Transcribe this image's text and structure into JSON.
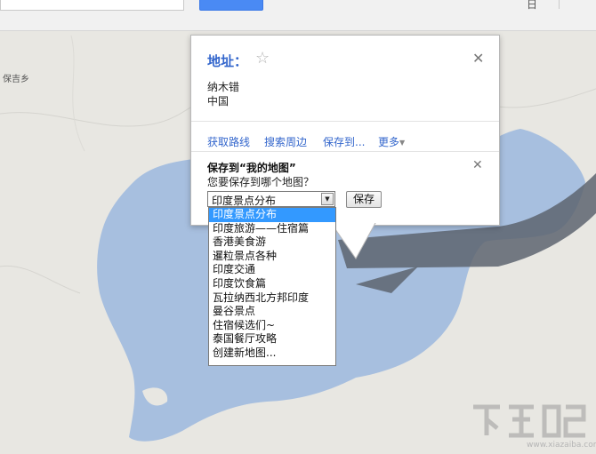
{
  "topbar": {
    "right_text": "日",
    "search_icon": "search-icon"
  },
  "map": {
    "place_label": "保吉乡",
    "lake_color": "#a7bfdf",
    "land_color": "#e8e7e2"
  },
  "popup": {
    "title": "地址：",
    "address_lines": [
      "纳木错",
      "中国"
    ],
    "actions": [
      "获取路线",
      "搜索周边",
      "保存到...",
      "更多"
    ],
    "save_section": {
      "title": "保存到“我的地图”",
      "question": "您要保存到哪个地图？",
      "selected_map": "印度景点分布",
      "save_button_label": "保存"
    }
  },
  "dropdown": {
    "options": [
      "印度景点分布",
      "印度旅游——住宿篇",
      "香港美食游",
      "暹粒景点各种",
      "印度交通",
      "印度饮食篇",
      "瓦拉纳西北方邦印度",
      "曼谷景点",
      "住宿候选们~",
      "泰国餐厅攻略",
      "创建新地图..."
    ],
    "selected_index": 0
  },
  "watermark": {
    "logo_text": "下载吧",
    "url": "www.xiazaiba.com"
  }
}
